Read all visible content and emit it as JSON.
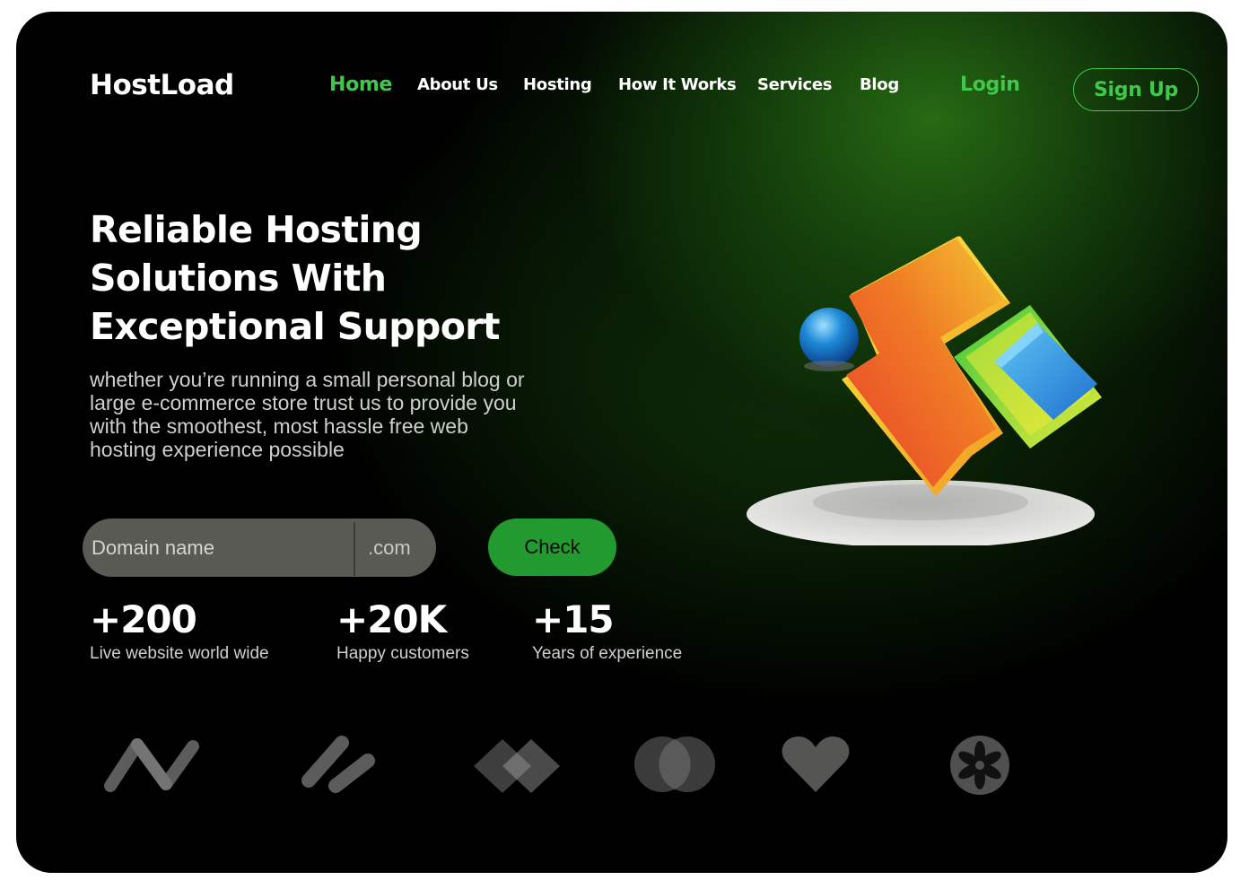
{
  "brand": {
    "name": "HostLoad"
  },
  "nav": {
    "items": [
      {
        "label": "Home",
        "active": true
      },
      {
        "label": "About Us",
        "active": false
      },
      {
        "label": "Hosting",
        "active": false
      },
      {
        "label": "How It Works",
        "active": false
      },
      {
        "label": "Services",
        "active": false
      },
      {
        "label": "Blog",
        "active": false
      }
    ],
    "login_label": "Login",
    "signup_label": "Sign Up"
  },
  "hero": {
    "title": "Reliable Hosting Solutions With Exceptional Support",
    "subtitle": "whether you’re running a small personal blog or large e-commerce store trust us to provide you with the smoothest, most hassle free web hosting experience possible"
  },
  "domain_search": {
    "placeholder": "Domain name",
    "tld": ".com",
    "button_label": "Check"
  },
  "stats": [
    {
      "value": "+200",
      "label": "Live website world wide"
    },
    {
      "value": "+20K",
      "label": "Happy customers"
    },
    {
      "value": "+15",
      "label": "Years of experience"
    }
  ],
  "partner_logos": [
    "zigzag-logo-icon",
    "slash-logo-icon",
    "diamonds-logo-icon",
    "circles-logo-icon",
    "heart-logo-icon",
    "flower-logo-icon"
  ],
  "colors": {
    "accent": "#3fc84a",
    "check_button": "#239a2f",
    "background": "#000000",
    "glow": "#1f5a10"
  }
}
